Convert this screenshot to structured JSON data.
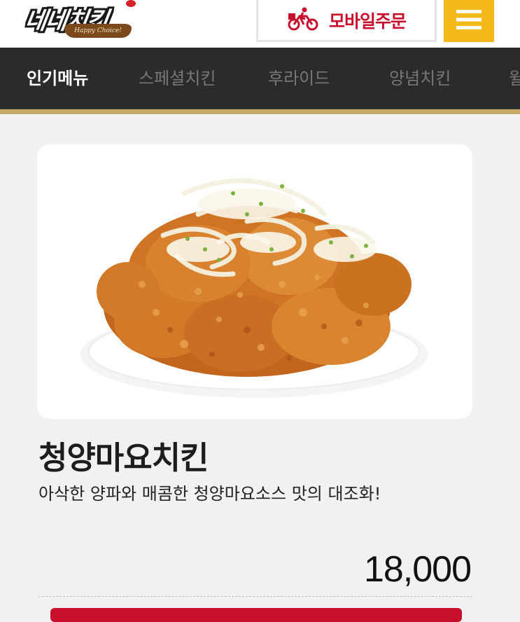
{
  "header": {
    "logo_text": "네네치킨",
    "logo_slogan": "Happy Choice!",
    "mobile_order_label": "모바일주문",
    "mobile_order_icon": "delivery-bike-icon",
    "menu_icon": "hamburger-menu-icon"
  },
  "nav": {
    "items": [
      {
        "label": "인기메뉴",
        "active": true
      },
      {
        "label": "스페셜치킨",
        "active": false
      },
      {
        "label": "후라이드",
        "active": false
      },
      {
        "label": "양념치킨",
        "active": false
      },
      {
        "label": "윌",
        "active": false
      }
    ]
  },
  "product": {
    "image_icon": "fried-chicken-image",
    "name": "청양마요치킨",
    "description": "아삭한 양파와 매콤한 청양마요소스 맛의 대조화!",
    "price": "18,000"
  },
  "colors": {
    "brand_red": "#c8102e",
    "menu_yellow": "#f3b81a",
    "nav_bg": "#2b2b2b",
    "nav_accent": "#c7a96b"
  }
}
